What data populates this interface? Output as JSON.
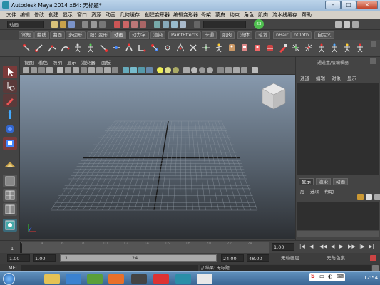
{
  "window": {
    "title": "Autodesk Maya 2014 x64: 无标题*",
    "buttons": [
      "-",
      "□",
      "×"
    ]
  },
  "menubar": [
    "文件",
    "编辑",
    "修改",
    "创建",
    "显示",
    "窗口",
    "资源",
    "动画",
    "几何缓存",
    "创建变形器",
    "编辑变形器",
    "骨架",
    "蒙皮",
    "约束",
    "角色",
    "肌肉",
    "流水线缓存",
    "帮助"
  ],
  "statusline": {
    "mode": "动画",
    "green_badge": "63"
  },
  "shelf_tabs": [
    "常规",
    "曲线",
    "曲面",
    "多边形",
    "细分曲面",
    "变形",
    "动画",
    "动力学",
    "渲染",
    "PaintEffects",
    "卡通",
    "肌肉",
    "流体",
    "毛发",
    "nHair",
    "nCloth",
    "自定义"
  ],
  "shelf_active_tab": "动画",
  "viewport": {
    "menu": [
      "视图",
      "着色",
      "照明",
      "显示",
      "渲染器",
      "面板"
    ]
  },
  "channelbox": {
    "header": "通道盒/层编辑器",
    "menu": [
      "通道",
      "编辑",
      "对象",
      "显示"
    ]
  },
  "layers": {
    "tabs": [
      "显示",
      "渲染",
      "动画"
    ],
    "active_tab": "显示",
    "menu": [
      "层",
      "选项",
      "帮助"
    ]
  },
  "timeslider": {
    "ticks": [
      "1",
      "2",
      "4",
      "6",
      "8",
      "10",
      "12",
      "14",
      "16",
      "18",
      "20",
      "22",
      "24"
    ],
    "current": "1.00"
  },
  "rangeslider": {
    "start": "1.00",
    "inner_start": "1.00",
    "handle_start": "1",
    "handle_end": "24",
    "inner_end": "24.00",
    "end": "48.00",
    "anim_layer": "无动画层",
    "char_set": "无角色集"
  },
  "cmdline": {
    "label": "MEL",
    "feedback": "// 结果: 无标题"
  },
  "taskbar": {
    "time": "12:54"
  },
  "colors": {
    "accent": "#6a6a6a",
    "grid_line": "#8c95a0",
    "axis_line": "#1a1a1a"
  }
}
